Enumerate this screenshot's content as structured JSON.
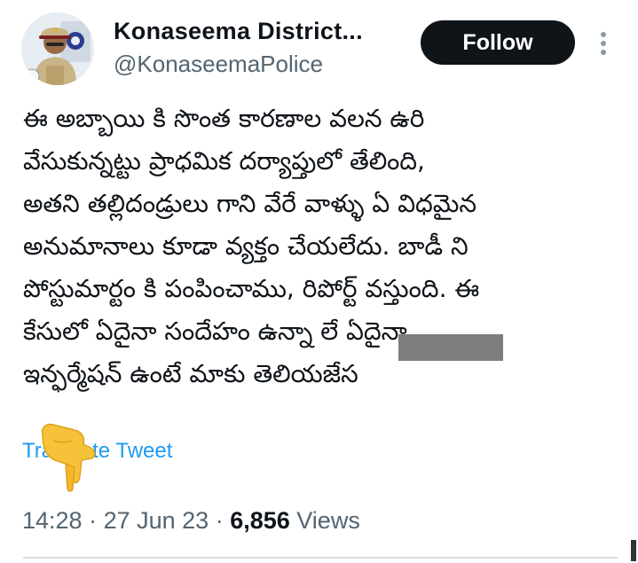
{
  "author": {
    "display_name": "Konaseema District...",
    "handle": "@KonaseemaPolice"
  },
  "follow_label": "Follow",
  "tweet": {
    "lines": [
      "ఈ అబ్బాయి కి సొంత కారణాల వలన ఉరి",
      "వేసుకున్నట్టు ప్రాధమిక దర్యాప్తులో తేలింది,",
      "అతని తల్లిదండ్రులు గాని వేరే వాళ్ళు ఏ విధమైన",
      "అనుమానాలు కూడా వ్యక్తం చేయలేదు. బాడీ ని",
      "పోస్టుమార్టం కి పంపించాము,  రిపోర్ట్ వస్తుంది. ఈ",
      "కేసులో ఏదైనా సందేహం ఉన్నా లే         ఏదైనా",
      "ఇన్ఫర్మేషన్ ఉంటే మాకు తెలియజేస"
    ]
  },
  "translate_label": "Translate Tweet",
  "meta": {
    "time": "14:28",
    "separator": " · ",
    "date": "27 Jun 23",
    "views_count": "6,856",
    "views_label": "Views"
  },
  "icons": {
    "more": "more-vertical-icon",
    "pointing": "pointing-hand-emoji"
  },
  "colors": {
    "follow_bg": "#0f1419",
    "link": "#1d9bf0",
    "secondary_text": "#536471"
  }
}
